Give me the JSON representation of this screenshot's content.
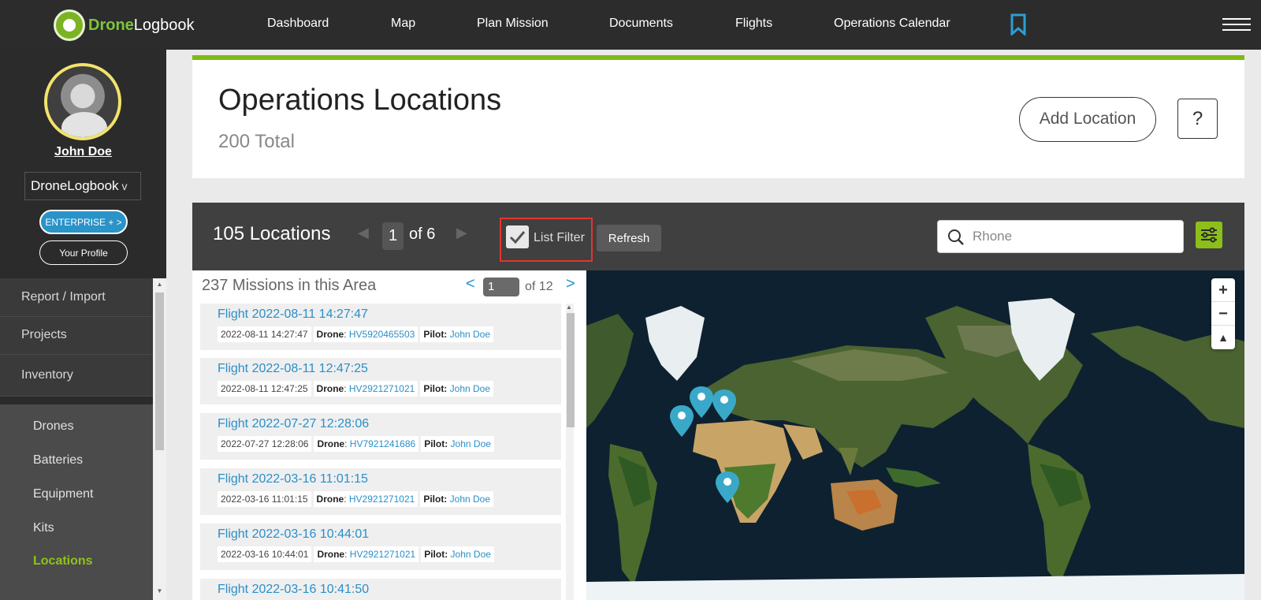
{
  "app": {
    "logo_accent": "Drone",
    "logo_rest": "Logbook",
    "nav": [
      "Dashboard",
      "Map",
      "Plan Mission",
      "Documents",
      "Flights",
      "Operations Calendar"
    ],
    "bookmark_icon": "bookmark-icon",
    "menu_icon": "hamburger-menu-icon"
  },
  "sidebar": {
    "user_name": "John Doe",
    "org": "DroneLogbook",
    "org_chevron": "v",
    "enterprise_label": "ENTERPRISE + >",
    "profile_label": "Your Profile",
    "menu": [
      "Report / Import",
      "Projects",
      "Inventory"
    ],
    "submenu": [
      "Drones",
      "Batteries",
      "Equipment",
      "Kits",
      "Locations"
    ],
    "active_item": "Locations"
  },
  "header": {
    "title": "Operations Locations",
    "total": "200 Total",
    "add_button": "Add Location",
    "help_button": "?"
  },
  "locations_bar": {
    "count": "105 Locations",
    "prev": "◀",
    "page": "1",
    "of_pages": "of 6",
    "next": "▶",
    "filter_label": "List Filter",
    "filter_checked": true,
    "refresh_label": "Refresh",
    "search_value": "",
    "search_placeholder": "Rhone"
  },
  "missions": {
    "title": "237 Missions in this Area",
    "prev": "<",
    "page": "1",
    "of_pages": "of 12",
    "next": ">",
    "drone_label": "Drone",
    "pilot_label": "Pilot:",
    "items": [
      {
        "title": "Flight 2022-08-11 14:27:47",
        "date": "2022-08-11 14:27:47",
        "drone": "HV5920465503",
        "pilot": "John Doe"
      },
      {
        "title": "Flight 2022-08-11 12:47:25",
        "date": "2022-08-11 12:47:25",
        "drone": "HV2921271021",
        "pilot": "John Doe"
      },
      {
        "title": "Flight 2022-07-27 12:28:06",
        "date": "2022-07-27 12:28:06",
        "drone": "HV7921241686",
        "pilot": "John Doe"
      },
      {
        "title": "Flight 2022-03-16 11:01:15",
        "date": "2022-03-16 11:01:15",
        "drone": "HV2921271021",
        "pilot": "John Doe"
      },
      {
        "title": "Flight 2022-03-16 10:44:01",
        "date": "2022-03-16 10:44:01",
        "drone": "HV2921271021",
        "pilot": "John Doe"
      },
      {
        "title": "Flight 2022-03-16 10:41:50",
        "date": "",
        "drone": "",
        "pilot": ""
      }
    ]
  },
  "map": {
    "zoom_in": "+",
    "zoom_out": "−",
    "reset_north": "▲"
  },
  "colors": {
    "accent_green": "#7fba14",
    "link_blue": "#2a8fc9",
    "nav_bg": "#2c2c2c",
    "highlight_red": "#e2362b",
    "marker_blue": "#3aa9c9"
  }
}
